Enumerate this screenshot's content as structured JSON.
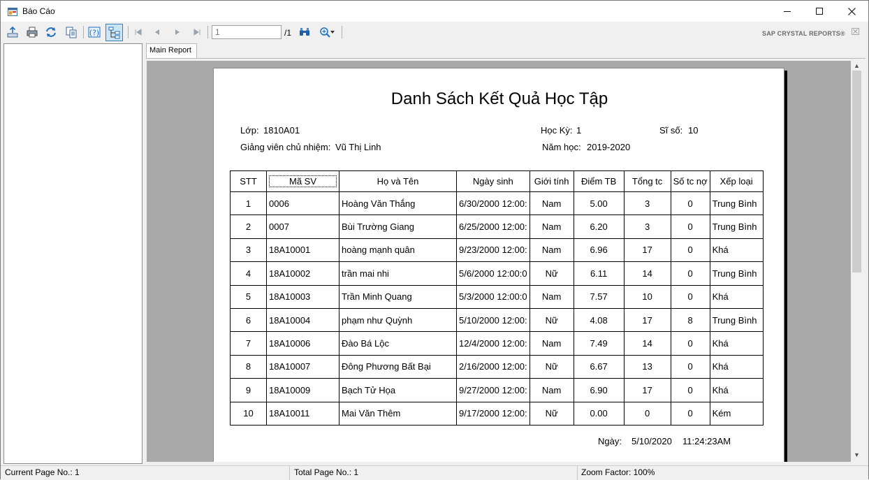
{
  "window": {
    "title": "Báo Cáo",
    "minimize": "—",
    "maximize": "☐",
    "close": "✕"
  },
  "toolbar": {
    "page_value": "1",
    "page_total": "/1",
    "brand": "SAP CRYSTAL REPORTS®"
  },
  "tabs": [
    {
      "label": "Main Report"
    }
  ],
  "report": {
    "title": "Danh Sách Kết Quả Học Tập",
    "lop_label": "Lớp:",
    "lop_value": "1810A01",
    "gv_label": "Giảng viên chủ nhiệm:",
    "gv_value": "Vũ Thị Linh",
    "hocky_label": "Học Kỳ:",
    "hocky_value": "1",
    "siso_label": "Sĩ số:",
    "siso_value": "10",
    "namhoc_label": "Năm học:",
    "namhoc_value": "2019-2020",
    "columns": [
      "STT",
      "Mã SV",
      "Họ và Tên",
      "Ngày sinh",
      "Giới tính",
      "Điểm TB",
      "Tổng tc",
      "Số tc nợ",
      "Xếp loại"
    ],
    "rows": [
      [
        "1",
        "0006",
        "Hoàng Văn Thắng",
        "6/30/2000  12:00:",
        "Nam",
        "5.00",
        "3",
        "0",
        "Trung Bình"
      ],
      [
        "2",
        "0007",
        "Bùi Trường Giang",
        "6/25/2000  12:00:",
        "Nam",
        "6.20",
        "3",
        "0",
        "Trung Bình"
      ],
      [
        "3",
        "18A10001",
        "hoàng mạnh quân",
        "9/23/2000  12:00:",
        "Nam",
        "6.96",
        "17",
        "0",
        "Khá"
      ],
      [
        "4",
        "18A10002",
        "trần mai nhi",
        "5/6/2000  12:00:0",
        "Nữ",
        "6.11",
        "14",
        "0",
        "Trung Bình"
      ],
      [
        "5",
        "18A10003",
        "Trần Minh Quang",
        "5/3/2000  12:00:0",
        "Nam",
        "7.57",
        "10",
        "0",
        "Khá"
      ],
      [
        "6",
        "18A10004",
        "phạm như Quỳnh",
        "5/10/2000  12:00:",
        "Nữ",
        "4.08",
        "17",
        "8",
        "Trung Bình"
      ],
      [
        "7",
        "18A10006",
        "Đào Bá Lộc",
        "12/4/2000  12:00:",
        "Nam",
        "7.49",
        "14",
        "0",
        "Khá"
      ],
      [
        "8",
        "18A10007",
        "Đông Phương Bất Bại",
        "2/16/2000  12:00:",
        "Nữ",
        "6.67",
        "13",
        "0",
        "Khá"
      ],
      [
        "9",
        "18A10009",
        "Bạch Tử Họa",
        "9/27/2000  12:00:",
        "Nam",
        "6.90",
        "17",
        "0",
        "Khá"
      ],
      [
        "10",
        "18A10011",
        "Mai Văn Thêm",
        "9/17/2000  12:00:",
        "Nữ",
        "0.00",
        "0",
        "0",
        "Kém"
      ]
    ],
    "footer_label": "Ngày:",
    "footer_date": "5/10/2020",
    "footer_time": "11:24:23AM"
  },
  "status": {
    "current_page": "Current Page No.: 1",
    "total_page": "Total Page No.: 1",
    "zoom": "Zoom Factor: 100%"
  },
  "colors": {
    "toolbar_bg": "#f0f0f0",
    "viewer_bg": "#a9a9a9",
    "page_bg": "#ffffff",
    "icon_blue": "#1e6fc2"
  }
}
